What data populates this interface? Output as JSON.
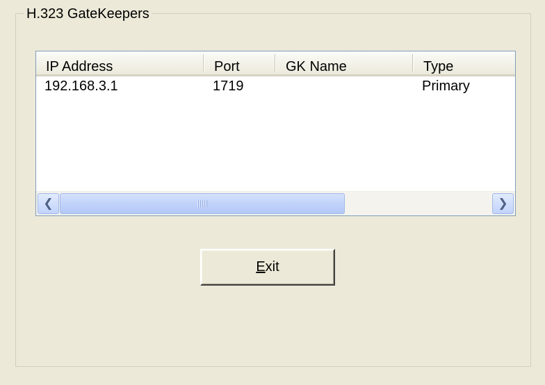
{
  "group": {
    "title": "H.323  GateKeepers"
  },
  "table": {
    "columns": [
      "IP Address",
      "Port",
      "GK Name",
      "Type"
    ],
    "rows": [
      {
        "ip": "192.168.3.1",
        "port": "1719",
        "gk_name": "",
        "type": "Primary"
      }
    ]
  },
  "scrollbar": {
    "left_icon": "chevron-left-icon",
    "right_icon": "chevron-right-icon",
    "thumb_grip_icon": "grip-icon"
  },
  "exit_button": {
    "mnemonic": "E",
    "rest": "xit"
  }
}
